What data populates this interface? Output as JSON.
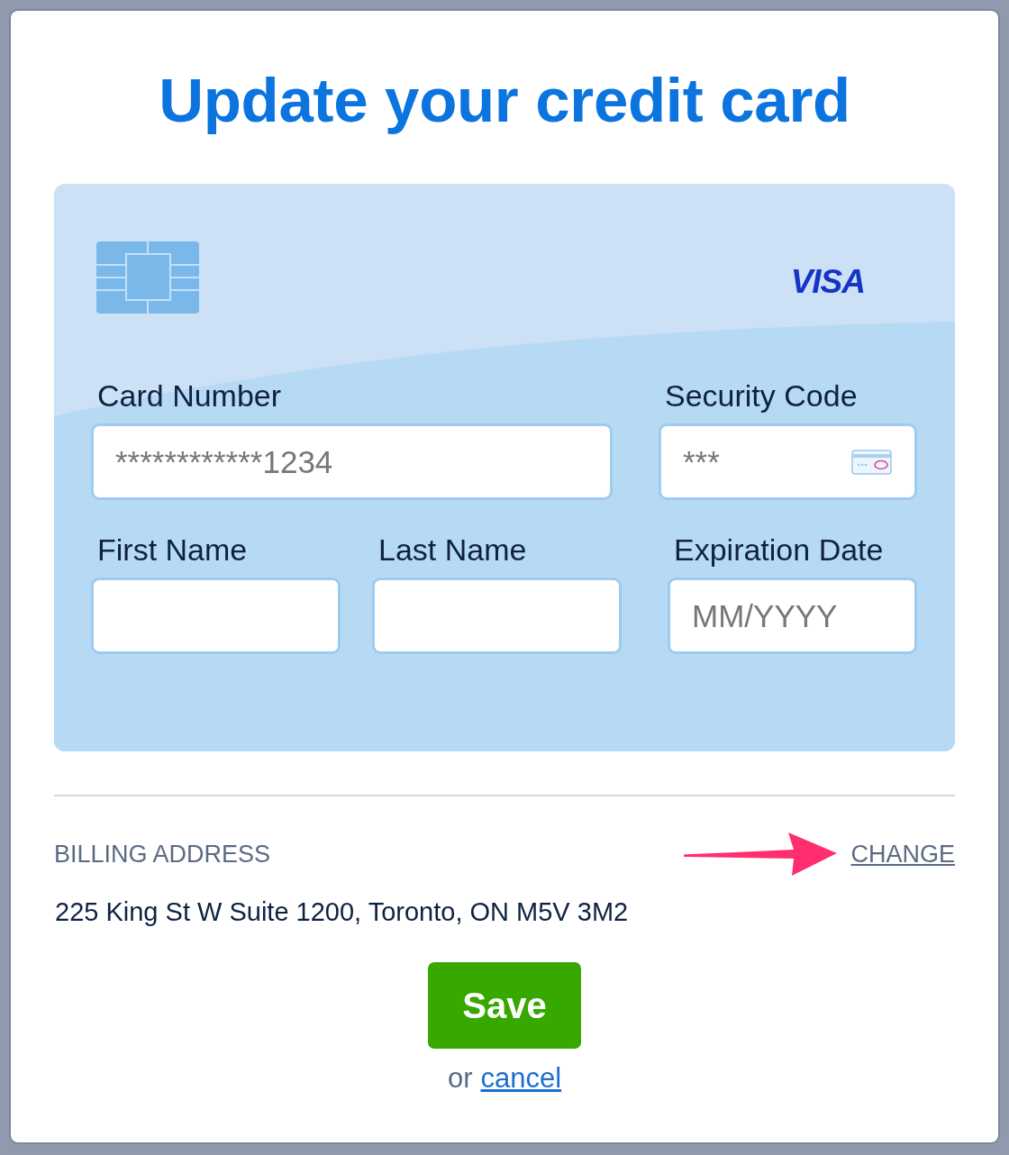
{
  "title": "Update your credit card",
  "card": {
    "brand": "VISA",
    "fields": [
      {
        "kind": "card_number",
        "label": "Card Number",
        "placeholder": "************1234"
      },
      {
        "kind": "security_code",
        "label": "Security Code",
        "placeholder": "***"
      },
      {
        "kind": "first_name",
        "label": "First Name"
      },
      {
        "kind": "last_name",
        "label": "Last Name"
      },
      {
        "kind": "expiration_date",
        "label": "Expiration Date",
        "placeholder": "MM/YYYY"
      }
    ]
  },
  "billing": {
    "label": "BILLING ADDRESS",
    "change_link": "CHANGE",
    "address": "225 King St W Suite 1200, Toronto, ON M5V 3M2"
  },
  "save_button": "Save",
  "cancel": {
    "prefix": "or",
    "link": "cancel"
  }
}
